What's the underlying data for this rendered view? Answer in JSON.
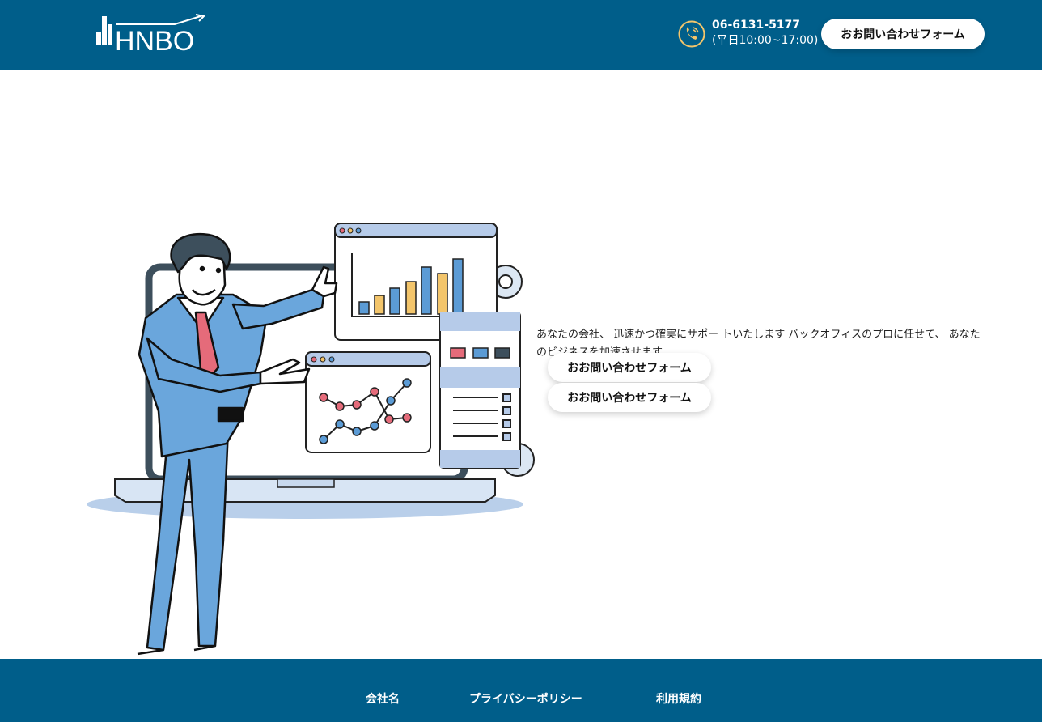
{
  "header": {
    "logo_text": "HNBO",
    "phone_icon": "phone-icon",
    "phone_number": "06-6131-5177",
    "phone_hours": "(平日10:00~17:00)",
    "contact_button": "おお問い合わせフォーム"
  },
  "hero": {
    "illustration": "businessman-presenting-charts",
    "text": "あなたの会社、 迅速かつ確実にサポー トいたします バックオフィスのプロに任せて、 あなたのビジネスを加速させます",
    "cta_primary": "おお問い合わせフォーム",
    "cta_secondary": "おお問い合わせフォーム"
  },
  "footer": {
    "links": [
      "会社名",
      "プライバシーポリシー",
      "利用規約"
    ]
  },
  "colors": {
    "brand": "#005e8a",
    "accent": "#f3c56b",
    "illustration_blue": "#5b9bd5"
  }
}
